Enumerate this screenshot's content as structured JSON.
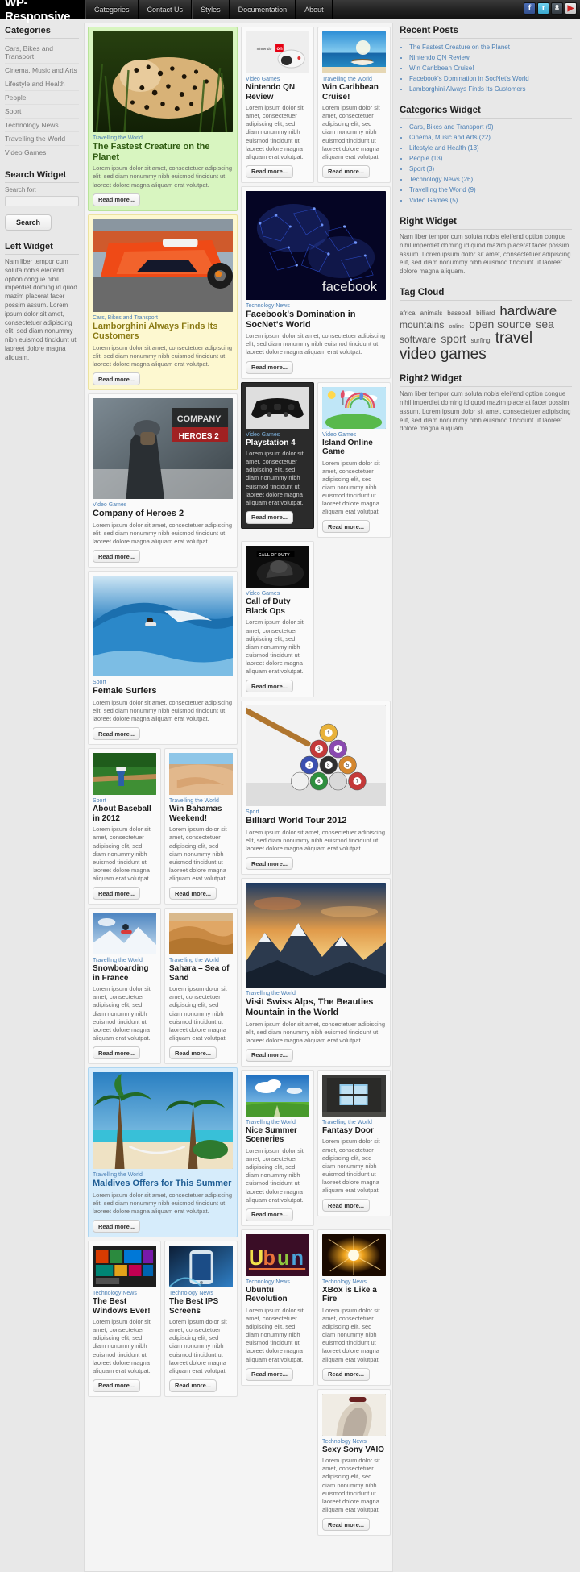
{
  "header": {
    "brand": "WP-Responsive",
    "nav": [
      {
        "label": "Categories"
      },
      {
        "label": "Contact Us"
      },
      {
        "label": "Styles"
      },
      {
        "label": "Documentation"
      },
      {
        "label": "About"
      }
    ],
    "social": [
      {
        "name": "facebook-icon",
        "glyph": "f"
      },
      {
        "name": "twitter-icon",
        "glyph": "t"
      },
      {
        "name": "googleplus-icon",
        "glyph": "8"
      },
      {
        "name": "youtube-icon",
        "glyph": "▶"
      }
    ]
  },
  "sidebar_left": {
    "categories": {
      "title": "Categories",
      "items": [
        "Cars, Bikes and Transport",
        "Cinema, Music and Arts",
        "Lifestyle and Health",
        "People",
        "Sport",
        "Technology News",
        "Travelling the World",
        "Video Games"
      ]
    },
    "search": {
      "title": "Search Widget",
      "label": "Search for:",
      "value": "",
      "placeholder": "",
      "button": "Search"
    },
    "left_widget": {
      "title": "Left Widget",
      "text": "Nam liber tempor cum soluta nobis eleifend option congue nihil imperdiet doming id quod mazim placerat facer possim assum. Lorem ipsum dolor sit amet, consectetuer adipiscing elit, sed diam nonummy nibh euismod tincidunt ut laoreet dolore magna aliquam."
    }
  },
  "sidebar_right": {
    "recent_posts": {
      "title": "Recent Posts",
      "items": [
        "The Fastest Creature on the Planet",
        "Nintendo QN Review",
        "Win Caribbean Cruise!",
        "Facebook's Domination in SocNet's World",
        "Lamborghini Always Finds Its Customers"
      ]
    },
    "categories_widget": {
      "title": "Categories Widget",
      "items": [
        "Cars, Bikes and Transport (9)",
        "Cinema, Music and Arts (22)",
        "Lifestyle and Health (13)",
        "People (13)",
        "Sport (3)",
        "Technology News (26)",
        "Travelling the World (9)",
        "Video Games (5)"
      ]
    },
    "right_widget": {
      "title": "Right Widget",
      "text": "Nam liber tempor cum soluta nobis eleifend option congue nihil imperdiet doming id quod mazim placerat facer possim assum. Lorem ipsum dolor sit amet, consectetuer adipiscing elit, sed diam nonummy nibh euismod tincidunt ut laoreet dolore magna aliquam."
    },
    "tag_cloud": {
      "title": "Tag Cloud",
      "tags": [
        {
          "label": "africa",
          "size": 8
        },
        {
          "label": "animals",
          "size": 8
        },
        {
          "label": "baseball",
          "size": 8
        },
        {
          "label": "billiard",
          "size": 8
        },
        {
          "label": "hardware",
          "size": 17
        },
        {
          "label": "mountains",
          "size": 12
        },
        {
          "label": "online",
          "size": 7
        },
        {
          "label": "open source",
          "size": 14
        },
        {
          "label": "sea",
          "size": 14
        },
        {
          "label": "software",
          "size": 12
        },
        {
          "label": "sport",
          "size": 14
        },
        {
          "label": "surfing",
          "size": 8
        },
        {
          "label": "travel",
          "size": 19
        },
        {
          "label": "video games",
          "size": 19
        }
      ]
    },
    "right2_widget": {
      "title": "Right2 Widget",
      "text": "Nam liber tempor cum soluta nobis eleifend option congue nihil imperdiet doming id quod mazim placerat facer possim assum. Lorem ipsum dolor sit amet, consectetuer adipiscing elit, sed diam nonummy nibh euismod tincidunt ut laoreet dolore magna aliquam."
    }
  },
  "common": {
    "excerpt": "Lorem ipsum dolor sit amet, consectetuer adipiscing elit, sed diam nonummy nibh euismod tincidunt ut laoreet dolore magna aliquam erat volutpat.",
    "read_more": "Read more..."
  },
  "posts": {
    "cheetah": {
      "cat": "Travelling the World",
      "title": "The Fastest Creature on the Planet"
    },
    "lambo": {
      "cat": "Cars, Bikes and Transport",
      "title": "Lamborghini Always Finds Its Customers"
    },
    "coh2": {
      "cat": "Video Games",
      "title": "Company of Heroes 2"
    },
    "surfers": {
      "cat": "Sport",
      "title": "Female Surfers"
    },
    "baseball": {
      "cat": "Sport",
      "title": "About Baseball in 2012"
    },
    "bahamas": {
      "cat": "Travelling the World",
      "title": "Win Bahamas Weekend!"
    },
    "snowboard": {
      "cat": "Travelling the World",
      "title": "Snowboarding in France"
    },
    "sahara": {
      "cat": "Travelling the World",
      "title": "Sahara – Sea of Sand"
    },
    "maldives": {
      "cat": "Travelling the World",
      "title": "Maldives Offers for This Summer"
    },
    "windows": {
      "cat": "Technology News",
      "title": "The Best Windows Ever!"
    },
    "iphone": {
      "cat": "Technology News",
      "title": "The Best IPS Screens"
    },
    "nintendo": {
      "cat": "Video Games",
      "title": "Nintendo QN Review"
    },
    "caribbean": {
      "cat": "Travelling the World",
      "title": "Win Caribbean Cruise!"
    },
    "facebook": {
      "cat": "Technology News",
      "title": "Facebook's Domination in SocNet's World"
    },
    "playstation": {
      "cat": "Video Games",
      "title": "Playstation 4"
    },
    "island": {
      "cat": "Video Games",
      "title": "Island Online Game"
    },
    "cod": {
      "cat": "Video Games",
      "title": "Call of Duty Black Ops"
    },
    "billiard": {
      "cat": "Sport",
      "title": "Billiard World Tour 2012"
    },
    "swissalps": {
      "cat": "Travelling the World",
      "title": "Visit Swiss Alps, The Beauties Mountain in the World"
    },
    "summer": {
      "cat": "Travelling the World",
      "title": "Nice Summer Sceneries"
    },
    "fantasydoor": {
      "cat": "Travelling the World",
      "title": "Fantasy Door"
    },
    "ubuntu": {
      "cat": "Technology News",
      "title": "Ubuntu Revolution"
    },
    "xbox": {
      "cat": "Technology News",
      "title": "XBox is Like a Fire"
    },
    "vaio": {
      "cat": "Technology News",
      "title": "Sexy Sony VAIO"
    }
  }
}
